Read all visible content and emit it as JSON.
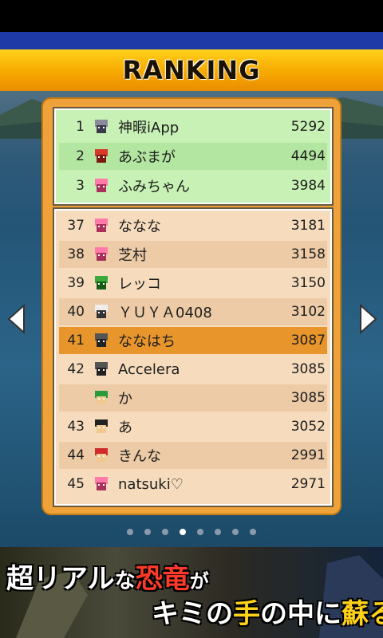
{
  "title": "RANKING",
  "top_ranks": [
    {
      "rank": "1",
      "name": "神暇iApp",
      "score": "5292",
      "avatar": "gray-cat-avatar-icon"
    },
    {
      "rank": "2",
      "name": "あぶまが",
      "score": "4494",
      "avatar": "red-dino-avatar-icon"
    },
    {
      "rank": "3",
      "name": "ふみちゃん",
      "score": "3984",
      "avatar": "pink-girl-avatar-icon"
    }
  ],
  "nearby_ranks": [
    {
      "rank": "37",
      "name": "ななな",
      "score": "3181",
      "avatar": "pink-girl-avatar-icon",
      "highlight": false,
      "alt": false
    },
    {
      "rank": "38",
      "name": "芝村",
      "score": "3158",
      "avatar": "pink-girl-avatar-icon",
      "highlight": false,
      "alt": true
    },
    {
      "rank": "39",
      "name": "レッコ",
      "score": "3150",
      "avatar": "green-frog-avatar-icon",
      "highlight": false,
      "alt": false
    },
    {
      "rank": "40",
      "name": "ＹＵＹＡ0408",
      "score": "3102",
      "avatar": "skull-avatar-icon",
      "highlight": false,
      "alt": true
    },
    {
      "rank": "41",
      "name": "ななはち",
      "score": "3087",
      "avatar": "masked-avatar-icon",
      "highlight": true,
      "alt": false
    },
    {
      "rank": "42",
      "name": "Accelera",
      "score": "3085",
      "avatar": "masked-avatar-icon",
      "highlight": false,
      "alt": false
    },
    {
      "rank": "",
      "name": "か",
      "score": "3085",
      "avatar": "green-cap-avatar-icon",
      "highlight": false,
      "alt": true
    },
    {
      "rank": "43",
      "name": "あ",
      "score": "3052",
      "avatar": "black-hair-avatar-icon",
      "highlight": false,
      "alt": false
    },
    {
      "rank": "44",
      "name": "きんな",
      "score": "2991",
      "avatar": "red-cap-avatar-icon",
      "highlight": false,
      "alt": true
    },
    {
      "rank": "45",
      "name": "natsuki♡",
      "score": "2971",
      "avatar": "pink-girl-avatar-icon",
      "highlight": false,
      "alt": false
    }
  ],
  "pager": {
    "total": 8,
    "active_index": 3
  },
  "banner": {
    "line1_a": "超リアル",
    "line1_b": "な",
    "line1_c": "恐竜",
    "line1_d": "が",
    "line2_a": "キミの",
    "line2_b": "手",
    "line2_c": "の中に",
    "line2_d": "蘇る"
  },
  "colors": {
    "panel": "#f0a23a",
    "top_box": "#c8f2b5",
    "row_alt": "#eccba6",
    "row_highlight": "#e8962c"
  }
}
